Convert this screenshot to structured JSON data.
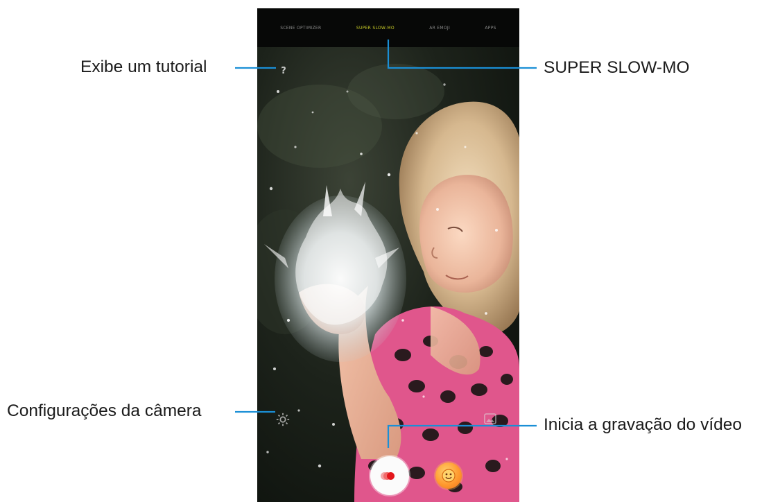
{
  "callouts": {
    "tutorial": "Exibe um tutorial",
    "super_slow_mo": "SUPER SLOW-MO",
    "camera_settings": "Configurações da câmera",
    "start_recording": "Inicia a gravação do vídeo"
  },
  "camera": {
    "modes": [
      "SCENE OPTIMIZER",
      "SUPER SLOW-MO",
      "AR EMOJI",
      "APPS"
    ],
    "active_mode": "SUPER SLOW-MO",
    "help_glyph": "?",
    "icons": {
      "help": "help-icon",
      "settings": "gear-icon",
      "gallery": "gallery-icon",
      "record": "record-icon",
      "emoji": "emoji-icon"
    }
  },
  "colors": {
    "callout_line": "#1a8fd6",
    "active_mode": "#c7ca28",
    "record_dot": "#e3161b",
    "emoji_orange": "#ff9a2f"
  }
}
